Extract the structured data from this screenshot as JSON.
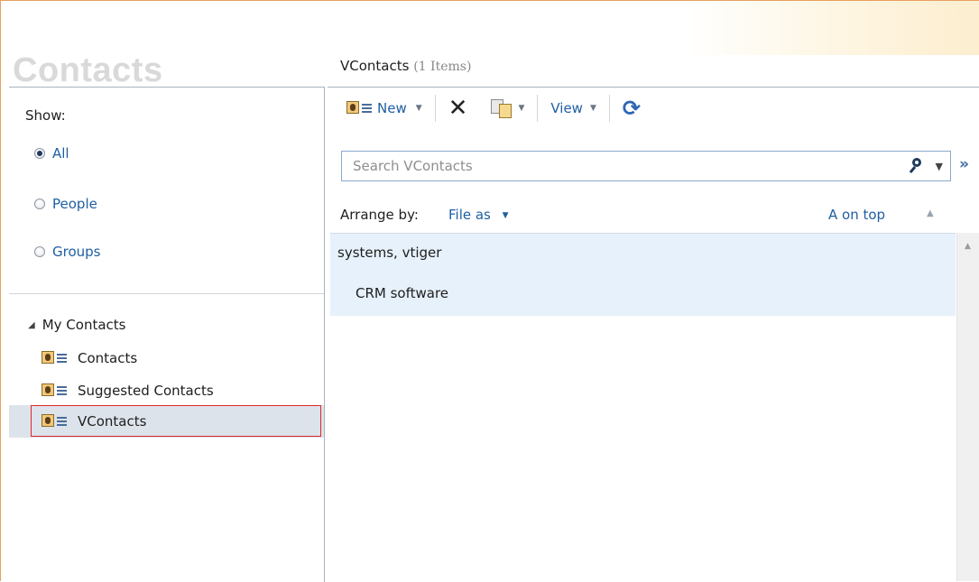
{
  "app": {
    "title": "Contacts"
  },
  "left_pane": {
    "show_label": "Show:",
    "filters": [
      {
        "label": "All",
        "selected": true
      },
      {
        "label": "People",
        "selected": false
      },
      {
        "label": "Groups",
        "selected": false
      }
    ],
    "tree": {
      "header": "My Contacts",
      "items": [
        {
          "label": "Contacts",
          "icon": "contact-card-icon"
        },
        {
          "label": "Suggested Contacts",
          "icon": "contact-card-icon"
        },
        {
          "label": "VContacts",
          "icon": "contact-card-icon",
          "selected": true
        }
      ]
    }
  },
  "folder": {
    "name": "VContacts",
    "count": "(1 Items)"
  },
  "toolbar": {
    "new_label": "New",
    "view_label": "View"
  },
  "search": {
    "placeholder": "Search VContacts",
    "value": ""
  },
  "arrange": {
    "label": "Arrange by:",
    "value": "File as",
    "order": "A on top"
  },
  "list": [
    {
      "name": "systems, vtiger",
      "company": "CRM software"
    }
  ],
  "colors": {
    "link_blue": "#1f5fa3",
    "selection_bg": "#dde3ea",
    "selection_outline": "#e0262d",
    "list_item_bg": "#e6f1fb"
  }
}
